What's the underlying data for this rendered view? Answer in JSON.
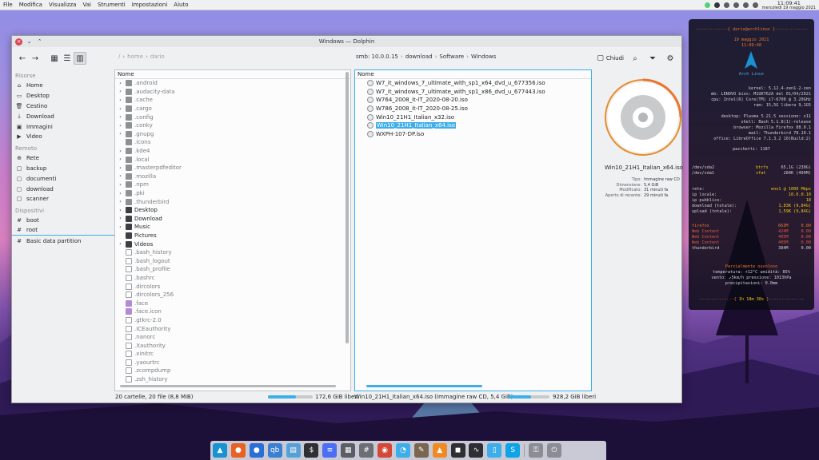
{
  "top_panel": {
    "menu": [
      "File",
      "Modifica",
      "Visualizza",
      "Vai",
      "Strumenti",
      "Impostazioni",
      "Aiuto"
    ],
    "clock_time": "11:09:41",
    "clock_date": "mercoledì 19 maggio 2021"
  },
  "window": {
    "title": "Windows — Dolphin"
  },
  "toolbar": {
    "breadcrumb_left": [
      "/",
      "home",
      "dario"
    ],
    "breadcrumb_right": [
      "smb: 10.0.0.15",
      "download",
      "Software",
      "Windows"
    ],
    "close_label": "Chiudi"
  },
  "places": {
    "sections": [
      {
        "title": "Risorse",
        "items": [
          {
            "label": "Home",
            "icon": "home-icon"
          },
          {
            "label": "Desktop",
            "icon": "desktop-icon"
          },
          {
            "label": "Cestino",
            "icon": "trash-icon"
          },
          {
            "label": "Download",
            "icon": "download-icon"
          },
          {
            "label": "Immagini",
            "icon": "image-icon"
          },
          {
            "label": "Video",
            "icon": "video-icon"
          }
        ]
      },
      {
        "title": "Remoto",
        "items": [
          {
            "label": "Rete",
            "icon": "network-icon"
          },
          {
            "label": "backup",
            "icon": "network-folder-icon"
          },
          {
            "label": "documenti",
            "icon": "network-folder-icon"
          },
          {
            "label": "download",
            "icon": "network-folder-icon"
          },
          {
            "label": "scanner",
            "icon": "network-folder-icon"
          }
        ]
      },
      {
        "title": "Dispositivi",
        "items": [
          {
            "label": "boot",
            "icon": "drive-icon"
          },
          {
            "label": "root",
            "icon": "drive-icon"
          },
          {
            "label": "Basic data partition",
            "icon": "drive-icon"
          }
        ]
      }
    ]
  },
  "left_pane": {
    "column_header": "Nome",
    "items": [
      {
        "name": ".android",
        "kind": "hfolder",
        "expandable": true
      },
      {
        "name": ".audacity-data",
        "kind": "hfolder",
        "expandable": true
      },
      {
        "name": ".cache",
        "kind": "hfolder",
        "expandable": true
      },
      {
        "name": ".cargo",
        "kind": "hfolder",
        "expandable": true
      },
      {
        "name": ".config",
        "kind": "hfolder",
        "expandable": true
      },
      {
        "name": ".conky",
        "kind": "hfolder",
        "expandable": true
      },
      {
        "name": ".gnupg",
        "kind": "hfolder",
        "expandable": true
      },
      {
        "name": ".icons",
        "kind": "hfolder",
        "expandable": false
      },
      {
        "name": ".kde4",
        "kind": "hfolder",
        "expandable": true
      },
      {
        "name": ".local",
        "kind": "hfolder",
        "expandable": true
      },
      {
        "name": ".masterpdfeditor",
        "kind": "hfolder",
        "expandable": true
      },
      {
        "name": ".mozilla",
        "kind": "hfolder",
        "expandable": true
      },
      {
        "name": ".npm",
        "kind": "hfolder",
        "expandable": true
      },
      {
        "name": ".pki",
        "kind": "hfolder",
        "expandable": true
      },
      {
        "name": ".thunderbird",
        "kind": "hfolder",
        "expandable": true
      },
      {
        "name": "Desktop",
        "kind": "folder",
        "expandable": true
      },
      {
        "name": "Download",
        "kind": "folder",
        "expandable": true
      },
      {
        "name": "Music",
        "kind": "folder",
        "expandable": true
      },
      {
        "name": "Pictures",
        "kind": "folder",
        "expandable": false
      },
      {
        "name": "Videos",
        "kind": "folder",
        "expandable": true
      },
      {
        "name": ".bash_history",
        "kind": "file",
        "expandable": false
      },
      {
        "name": ".bash_logout",
        "kind": "file",
        "expandable": false
      },
      {
        "name": ".bash_profile",
        "kind": "file",
        "expandable": false
      },
      {
        "name": ".bashrc",
        "kind": "file",
        "expandable": false
      },
      {
        "name": ".dircolors",
        "kind": "file",
        "expandable": false
      },
      {
        "name": ".dircolors_256",
        "kind": "file",
        "expandable": false
      },
      {
        "name": ".face",
        "kind": "img",
        "expandable": false
      },
      {
        "name": ".face.icon",
        "kind": "img",
        "expandable": false
      },
      {
        "name": ".gtkrc-2.0",
        "kind": "file",
        "expandable": false
      },
      {
        "name": ".ICEauthority",
        "kind": "file",
        "expandable": false
      },
      {
        "name": ".nanorc",
        "kind": "file",
        "expandable": false
      },
      {
        "name": ".Xauthority",
        "kind": "file",
        "expandable": false
      },
      {
        "name": ".xinitrc",
        "kind": "file",
        "expandable": false
      },
      {
        "name": ".yaourtrc",
        "kind": "file",
        "expandable": false
      },
      {
        "name": ".zcompdump",
        "kind": "file",
        "expandable": false
      },
      {
        "name": ".zsh_history",
        "kind": "file",
        "expandable": false
      }
    ]
  },
  "right_pane": {
    "column_header": "Nome",
    "items": [
      {
        "name": "W7_it_windows_7_ultimate_with_sp1_x64_dvd_u_677356.iso",
        "selected": false
      },
      {
        "name": "W7_it_windows_7_ultimate_with_sp1_x86_dvd_u_677443.iso",
        "selected": false
      },
      {
        "name": "W764_2008_it-IT_2020-08-20.iso",
        "selected": false
      },
      {
        "name": "W786_2008_it-IT_2020-08-25.iso",
        "selected": false
      },
      {
        "name": "Win10_21H1_Italian_x32.iso",
        "selected": false
      },
      {
        "name": "Win10_21H1_Italian_x64.iso",
        "selected": true
      },
      {
        "name": "WXPH-107-DP.iso",
        "selected": false
      }
    ]
  },
  "info_panel": {
    "file_name": "Win10_21H1_Italian_x64.iso",
    "fields": [
      {
        "key": "Tipo:",
        "value": "Immagine raw CD"
      },
      {
        "key": "Dimensione:",
        "value": "5,4 GiB"
      },
      {
        "key": "Modificato:",
        "value": "31 minuti fa"
      },
      {
        "key": "Aperto di recente:",
        "value": "29 minuti fa"
      }
    ]
  },
  "status_bar": {
    "left_summary": "20 cartelle, 20 file (8,8 MiB)",
    "left_free": "172,6 GiB liberi",
    "left_used_fraction": 0.62,
    "right_summary": "Win10_21H1_Italian_x64.iso (Immagine raw CD, 5,4 GiB)",
    "right_free": "928,2 GiB liberi",
    "right_used_fraction": 0.55
  },
  "conky": {
    "user_host": "dario@archlinux",
    "date": "19 maggio 2021",
    "time": "11:09:40",
    "distro": "Arch Linux",
    "kernel": "kernel: 5.12.4-zen1-2-zen",
    "mb": "mb: LENOVO bios: M1UKT62A del 01/04/2021",
    "cpu": "cpu: Intel(R) Core(TM) i7-6700 @ 3.20GHz",
    "ram": "ram: 15,5G libera 9,1G5",
    "desktop": "desktop: Plasma 5.21.5 sessione: x11",
    "shell": "shell: Bash 5.1.8(1)-release",
    "browser": "browser: Mozilla Firefox 88.0.1",
    "mail": "mail: Thunderbird 78.10.1",
    "office": "office: LibreOffice 7.1.3.2 10(Build:2)",
    "packages": "pacchetti: 1187",
    "disks": [
      {
        "dev": "/dev/sda2",
        "fs": "btrfs",
        "size": "65,1G (230G)"
      },
      {
        "dev": "/dev/sda1",
        "fs": "vfat",
        "size": "284K (499M)"
      }
    ],
    "net_title": "rete:",
    "net_speed": "eno1 @ 1000 Mbps",
    "ip_local_label": "ip locale:",
    "ip_local": "10.0.0.10",
    "ip_public_label": "ip pubblico:",
    "ip_public": "18",
    "download_label": "download (totale):",
    "download": "1,83K (9,84G)",
    "upload_label": "upload (totale):",
    "upload": "1,59K (9,84G)",
    "procs": [
      {
        "name": "firefox",
        "mem": "663M",
        "pct": "0.00"
      },
      {
        "name": "Web Content",
        "mem": "424M",
        "pct": "0.00"
      },
      {
        "name": "Web Content",
        "mem": "405M",
        "pct": "0.00"
      },
      {
        "name": "Web Content",
        "mem": "405M",
        "pct": "0.00"
      },
      {
        "name": "thunderbird",
        "mem": "384M",
        "pct": "0.00"
      }
    ],
    "weather_title": "Parzialmente nuvoloso",
    "weather_temp": "temperatura: +12°C umidità: 85%",
    "weather_wind": "vento: ↙5km/h pressione: 1013hPa",
    "weather_rain": "precipitazioni: 0.0mm",
    "uptime": "1h 18m 38s"
  },
  "dock": {
    "icons": [
      {
        "name": "arch-launcher-icon",
        "glyph": "▲",
        "color": "#1793d1"
      },
      {
        "name": "firefox-icon",
        "glyph": "●",
        "color": "#e86125"
      },
      {
        "name": "thunderbird-icon",
        "glyph": "●",
        "color": "#2a6fd6"
      },
      {
        "name": "qbittorrent-icon",
        "glyph": "qb",
        "color": "#3a7fd0"
      },
      {
        "name": "dolphin-icon",
        "glyph": "▤",
        "color": "#5a9fd4"
      },
      {
        "name": "konsole-icon",
        "glyph": "$",
        "color": "#2d2f33"
      },
      {
        "name": "kate-icon",
        "glyph": "≡",
        "color": "#4c6ef5"
      },
      {
        "name": "libreoffice-icon",
        "glyph": "▦",
        "color": "#5a5e66"
      },
      {
        "name": "calculator-icon",
        "glyph": "#",
        "color": "#6b6f75"
      },
      {
        "name": "chromium-icon",
        "glyph": "◉",
        "color": "#d34836"
      },
      {
        "name": "disk-usage-icon",
        "glyph": "◔",
        "color": "#3daee9"
      },
      {
        "name": "gimp-icon",
        "glyph": "✎",
        "color": "#7a6650"
      },
      {
        "name": "vlc-icon",
        "glyph": "▲",
        "color": "#f08a24"
      },
      {
        "name": "media-player-icon",
        "glyph": "◼",
        "color": "#2d2f33"
      },
      {
        "name": "system-monitor-icon",
        "glyph": "∿",
        "color": "#2d2f33"
      },
      {
        "name": "document-viewer-icon",
        "glyph": "▯",
        "color": "#3daee9"
      },
      {
        "name": "skype-icon",
        "glyph": "S",
        "color": "#0fa4e6"
      },
      {
        "name": "lock-screen-icon",
        "glyph": "⚿",
        "color": "#8a8e94"
      },
      {
        "name": "power-icon",
        "glyph": "⏻",
        "color": "#8a8e94"
      }
    ]
  }
}
